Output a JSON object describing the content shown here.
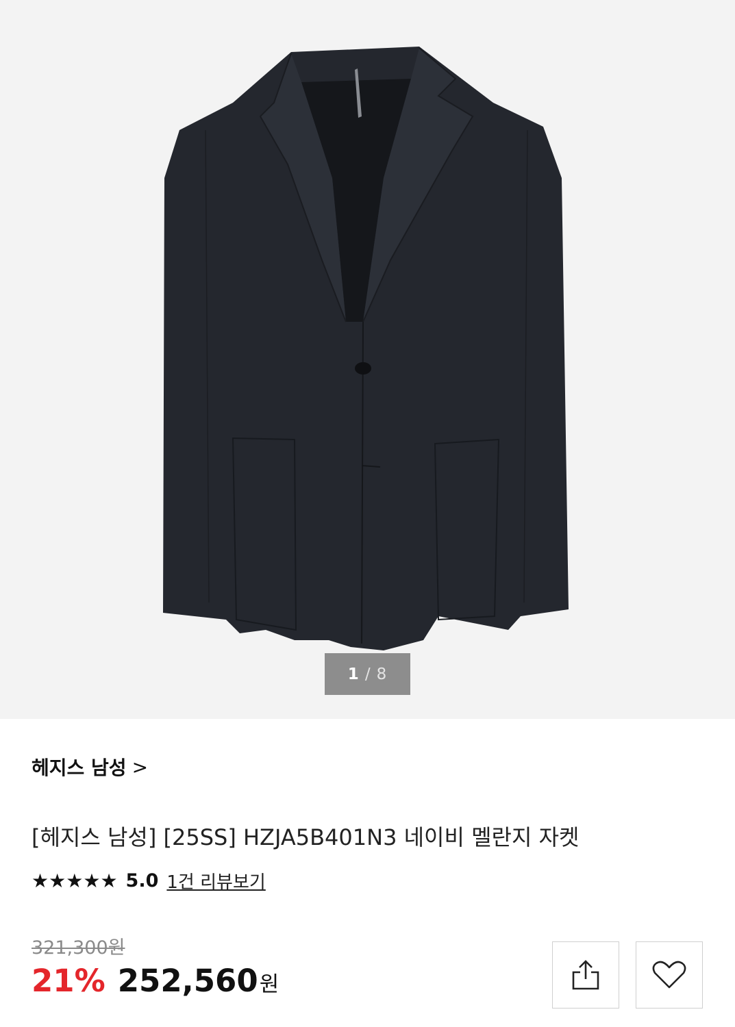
{
  "gallery": {
    "current": "1",
    "separator": "/",
    "total": "8"
  },
  "brand": {
    "label": "헤지스 남성",
    "chevron": ">"
  },
  "product": {
    "title": "[헤지스 남성] [25SS] HZJA5B401N3 네이비 멜란지 자켓"
  },
  "rating": {
    "stars": 5,
    "score": "5.0",
    "review_link": "1건 리뷰보기"
  },
  "price": {
    "original": "321,300원",
    "discount": "21%",
    "sale": "252,560",
    "currency": "원"
  },
  "actions": {
    "share_icon": "share-icon",
    "wishlist_icon": "heart-outline-icon"
  },
  "colors": {
    "discount": "#e4262b",
    "gallery_bg": "#f3f3f3",
    "counter_bg": "#8d8d8d"
  }
}
